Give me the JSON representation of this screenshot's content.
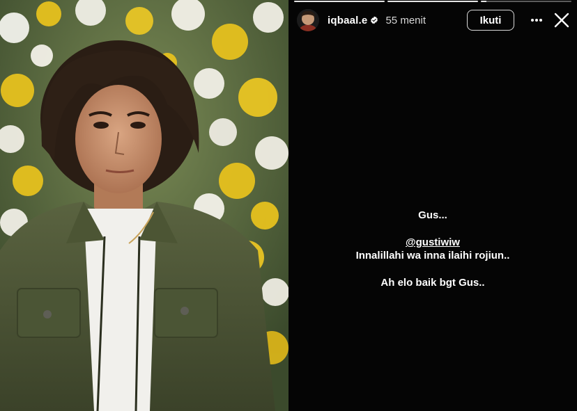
{
  "story": {
    "username": "iqbaal.e",
    "time": "55 menit",
    "follow_label": "Ikuti",
    "more_icon": "more-horizontal-icon",
    "close_icon": "close-icon",
    "verified_icon": "verified-badge-icon",
    "progress_segments": 3,
    "lines": {
      "greeting": "Gus...",
      "mention": "@gustiwiw",
      "prayer": "Innalillahi wa inna ilaihi rojiun..",
      "closing": "Ah elo baik bgt Gus.."
    }
  },
  "colors": {
    "story_background": "#050505",
    "text": "#ffffff",
    "jacket": "#4b5535",
    "flowers_yellow": "#e6c11e"
  }
}
